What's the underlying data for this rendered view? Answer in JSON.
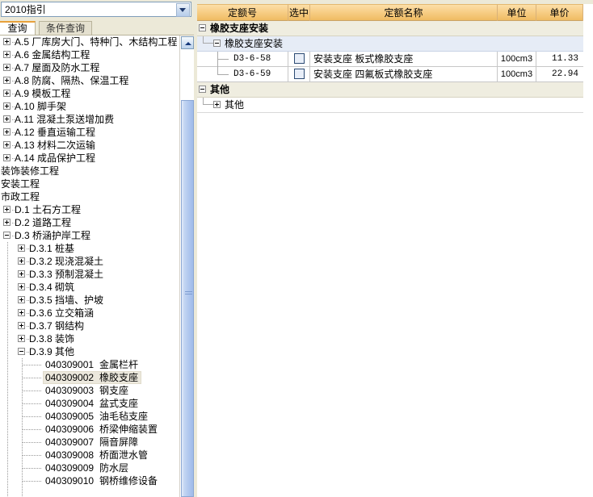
{
  "combo": {
    "value": "2010指引",
    "caret_icon": "chevron-down-icon"
  },
  "tabs": [
    {
      "label": "查询",
      "active": true
    },
    {
      "label": "条件查询",
      "active": false
    }
  ],
  "tree": {
    "nodes": [
      {
        "label": "A.5  厂库房大门、特种门、木结构工程",
        "depth": 0,
        "state": "collapsed"
      },
      {
        "label": "A.6  金属结构工程",
        "depth": 0,
        "state": "collapsed"
      },
      {
        "label": "A.7  屋面及防水工程",
        "depth": 0,
        "state": "collapsed"
      },
      {
        "label": "A.8  防腐、隔热、保温工程",
        "depth": 0,
        "state": "collapsed"
      },
      {
        "label": "A.9  模板工程",
        "depth": 0,
        "state": "collapsed"
      },
      {
        "label": "A.10  脚手架",
        "depth": 0,
        "state": "collapsed"
      },
      {
        "label": "A.11  混凝土泵送增加费",
        "depth": 0,
        "state": "collapsed"
      },
      {
        "label": "A.12  垂直运输工程",
        "depth": 0,
        "state": "collapsed"
      },
      {
        "label": "A.13  材料二次运输",
        "depth": 0,
        "state": "collapsed"
      },
      {
        "label": "A.14  成品保护工程",
        "depth": 0,
        "state": "collapsed"
      },
      {
        "label": "装饰装修工程",
        "depth": -1,
        "state": "root"
      },
      {
        "label": "安装工程",
        "depth": -1,
        "state": "root"
      },
      {
        "label": "市政工程",
        "depth": -1,
        "state": "root"
      },
      {
        "label": "D.1  土石方工程",
        "depth": 0,
        "state": "collapsed"
      },
      {
        "label": "D.2  道路工程",
        "depth": 0,
        "state": "collapsed"
      },
      {
        "label": "D.3  桥涵护岸工程",
        "depth": 0,
        "state": "expanded"
      },
      {
        "label": "D.3.1  桩基",
        "depth": 1,
        "state": "collapsed"
      },
      {
        "label": "D.3.2  现浇混凝土",
        "depth": 1,
        "state": "collapsed"
      },
      {
        "label": "D.3.3  预制混凝土",
        "depth": 1,
        "state": "collapsed"
      },
      {
        "label": "D.3.4  砌筑",
        "depth": 1,
        "state": "collapsed"
      },
      {
        "label": "D.3.5  挡墙、护坡",
        "depth": 1,
        "state": "collapsed"
      },
      {
        "label": "D.3.6  立交箱涵",
        "depth": 1,
        "state": "collapsed"
      },
      {
        "label": "D.3.7  钢结构",
        "depth": 1,
        "state": "collapsed"
      },
      {
        "label": "D.3.8  装饰",
        "depth": 1,
        "state": "collapsed"
      },
      {
        "label": "D.3.9  其他",
        "depth": 1,
        "state": "expanded"
      }
    ],
    "leaves": [
      {
        "code": "040309001",
        "label": "金属栏杆",
        "selected": false
      },
      {
        "code": "040309002",
        "label": "橡胶支座",
        "selected": true
      },
      {
        "code": "040309003",
        "label": "钢支座",
        "selected": false
      },
      {
        "code": "040309004",
        "label": "盆式支座",
        "selected": false
      },
      {
        "code": "040309005",
        "label": "油毛毡支座",
        "selected": false
      },
      {
        "code": "040309006",
        "label": "桥梁伸缩装置",
        "selected": false
      },
      {
        "code": "040309007",
        "label": "隔音屏障",
        "selected": false
      },
      {
        "code": "040309008",
        "label": "桥面泄水管",
        "selected": false
      },
      {
        "code": "040309009",
        "label": "防水层",
        "selected": false
      },
      {
        "code": "040309010",
        "label": "钢桥维修设备",
        "selected": false
      }
    ],
    "scrollbar": {
      "up_arrow_icon": "scroll-up-arrow-icon"
    }
  },
  "grid": {
    "columns": [
      {
        "label": "定额号"
      },
      {
        "label": "选中"
      },
      {
        "label": "定额名称"
      },
      {
        "label": "单位"
      },
      {
        "label": "单价"
      }
    ],
    "rows": [
      {
        "kind": "group",
        "indent": 0,
        "state": "expanded",
        "name": "橡胶支座安装"
      },
      {
        "kind": "sub",
        "indent": 1,
        "state": "expanded",
        "name": "橡胶支座安装"
      },
      {
        "kind": "data",
        "code": "D3-6-58",
        "checked": false,
        "name": "安装支座  板式橡胶支座",
        "unit": "100cm3",
        "price": "11.33"
      },
      {
        "kind": "data",
        "code": "D3-6-59",
        "checked": false,
        "name": "安装支座  四氟板式橡胶支座",
        "unit": "100cm3",
        "price": "22.94"
      },
      {
        "kind": "group",
        "indent": 0,
        "state": "expanded",
        "name": "其他"
      },
      {
        "kind": "sub2",
        "indent": 1,
        "state": "collapsed",
        "name": "其他"
      }
    ]
  }
}
